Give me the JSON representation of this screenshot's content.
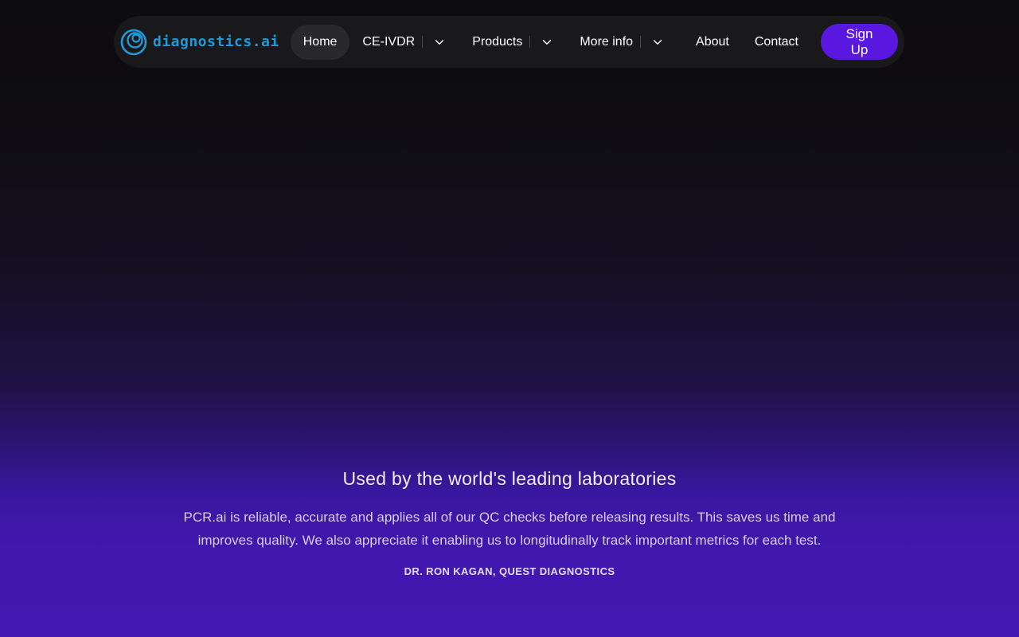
{
  "nav": {
    "logo": {
      "icon": "diagnostics-logo-icon",
      "text_main": "diagnostics",
      "text_suffix": ".ai"
    },
    "items": {
      "home": "Home",
      "ceivdr": "CE-IVDR",
      "products": "Products",
      "more_info": "More info",
      "about": "About",
      "contact": "Contact"
    },
    "signup_label": "Sign Up"
  },
  "testimonial": {
    "heading": "Used by the world's leading laboratories",
    "quote": "PCR.ai is reliable, accurate and applies all of our QC checks before releasing results. This saves us time and improves quality. We also appreciate it enabling us to longitudinally track important metrics for each test.",
    "author": "DR. RON KAGAN, QUEST DIAGNOSTICS"
  },
  "colors": {
    "accent": "#5a17e0",
    "logo": "#1e9bd6",
    "nav_bg": "#19181b",
    "gradient_bottom": "#4418b2"
  }
}
